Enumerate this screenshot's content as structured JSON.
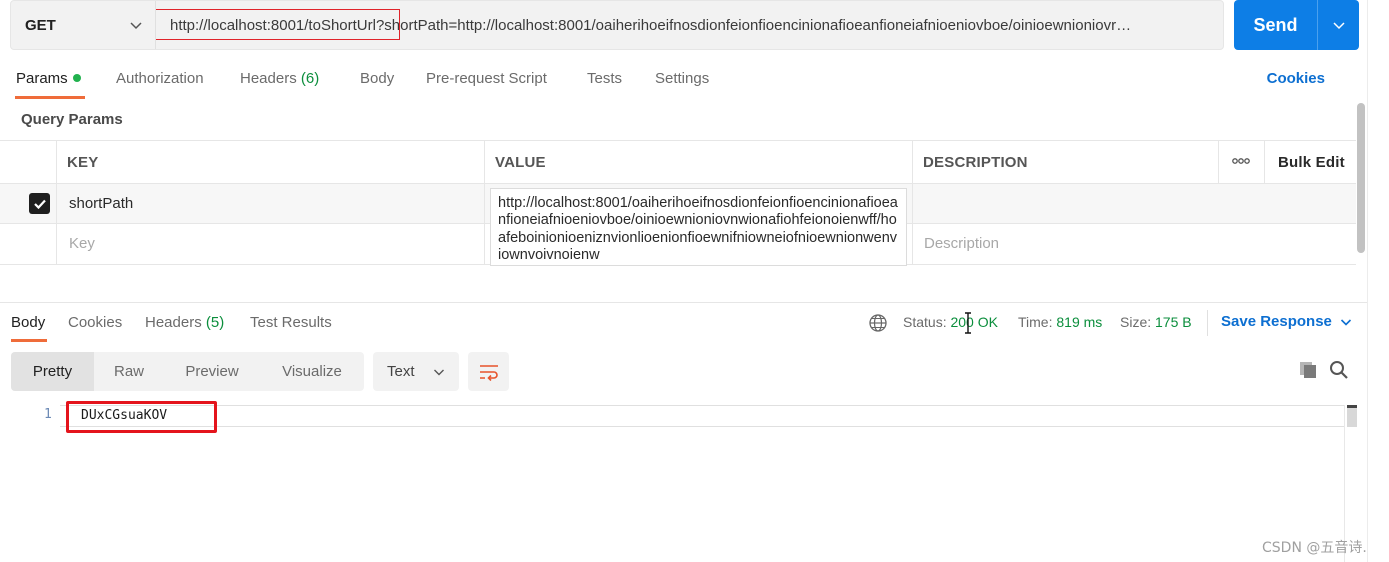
{
  "request": {
    "method": "GET",
    "url": "http://localhost:8001/toShortUrl?shortPath=http://localhost:8001/oaiherihoeifnosdionfeionfioencinionafioeanfioneiafnioeniovboe/oinioewnioniovr…",
    "send_label": "Send"
  },
  "tabs": {
    "params": "Params",
    "authorization": "Authorization",
    "headers": "Headers",
    "headers_count": "(6)",
    "body": "Body",
    "pre_request": "Pre-request Script",
    "tests": "Tests",
    "settings": "Settings",
    "cookies": "Cookies"
  },
  "query_params": {
    "title": "Query Params",
    "columns": {
      "key": "KEY",
      "value": "VALUE",
      "description": "DESCRIPTION",
      "bulk_edit": "Bulk Edit"
    },
    "rows": [
      {
        "key": "shortPath",
        "value": "http://localhost:8001/oaiherihoeifnosdionfeionfioencinionafioeanfioneiafnioeniovboe/oinioewnioniovnwionafiohfeionoienwff/hoafeboinionioeniznvionlioenionfioewnifniowneiofnioewnionwenviownvoivnoienw",
        "checked": true
      }
    ],
    "placeholder_key": "Key",
    "placeholder_description": "Description"
  },
  "response": {
    "tabs": {
      "body": "Body",
      "cookies": "Cookies",
      "headers": "Headers",
      "headers_count": "(5)",
      "test_results": "Test Results"
    },
    "status_label": "Status:",
    "status_value": "200 OK",
    "time_label": "Time:",
    "time_value": "819 ms",
    "size_label": "Size:",
    "size_value": "175 B",
    "save_response": "Save Response",
    "formats": [
      "Pretty",
      "Raw",
      "Preview",
      "Visualize"
    ],
    "format_type": "Text",
    "line_number": "1",
    "body_text": "DUxCGsuaKOV"
  },
  "watermark": "CSDN @五音诗.",
  "colors": {
    "accent": "#0d7ee6",
    "tab_underline": "#ef6c3a",
    "success": "#0b8e3c",
    "highlight_box": "#e4141c"
  }
}
